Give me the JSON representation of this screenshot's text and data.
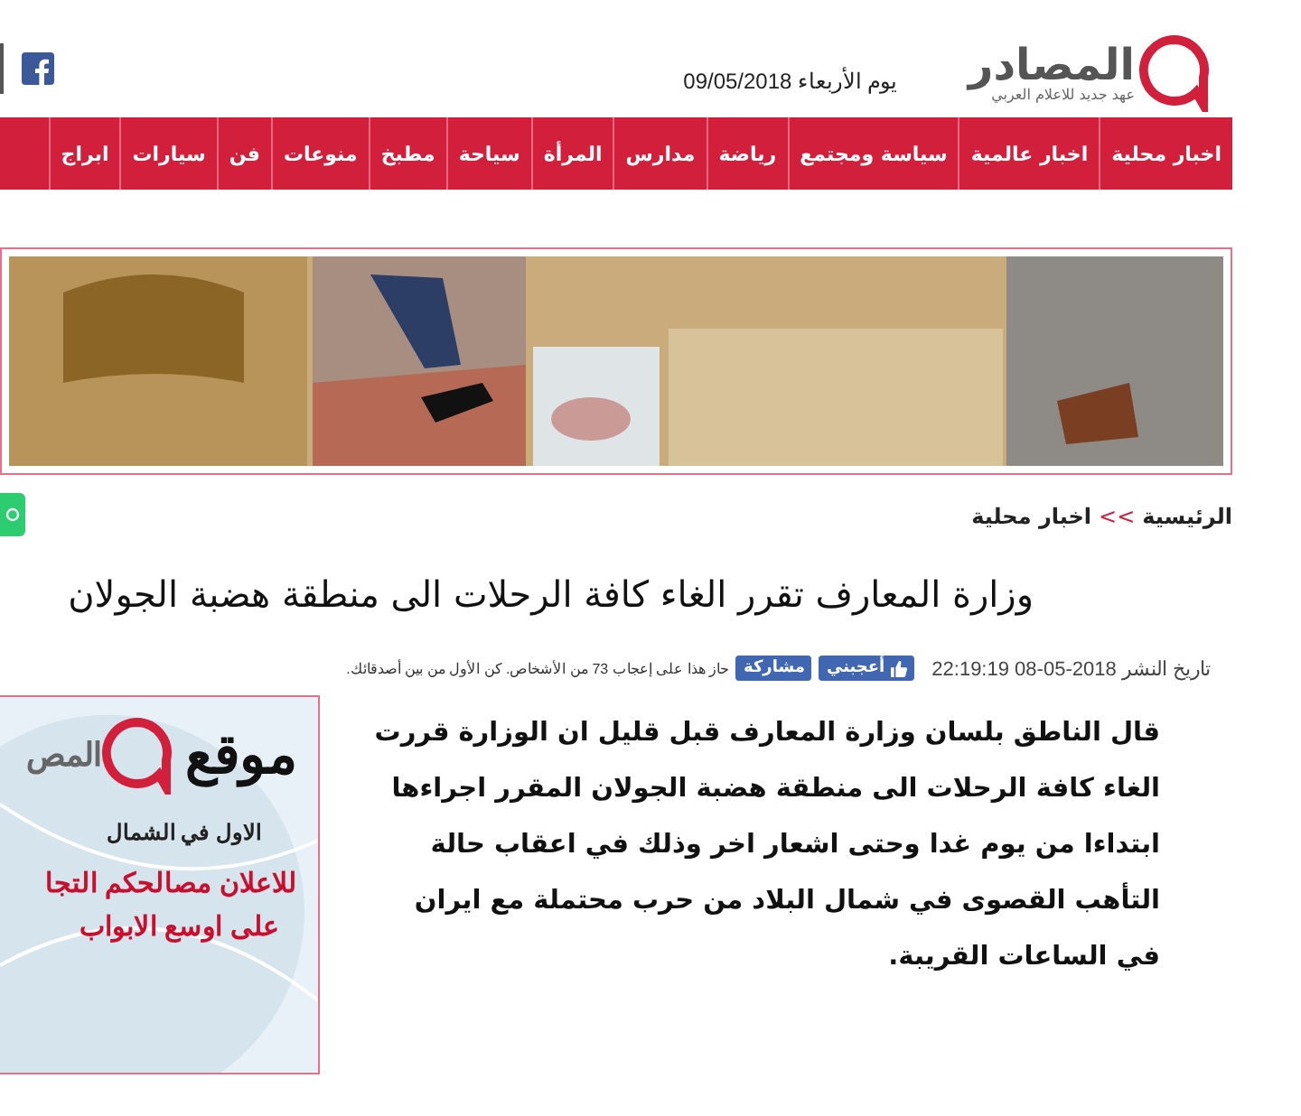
{
  "header": {
    "logo": {
      "name": "المصادر",
      "tagline": "عهد جديد للاعلام العربي"
    },
    "date": "يوم الأربعاء 09/05/2018"
  },
  "nav": [
    {
      "label": "اخبار محلية"
    },
    {
      "label": "اخبار عالمية"
    },
    {
      "label": "سياسة ومجتمع"
    },
    {
      "label": "رياضة"
    },
    {
      "label": "مدارس"
    },
    {
      "label": "المرأة"
    },
    {
      "label": "سياحة"
    },
    {
      "label": "مطبخ"
    },
    {
      "label": "منوعات"
    },
    {
      "label": "فن"
    },
    {
      "label": "سيارات"
    },
    {
      "label": "ابراج"
    }
  ],
  "breadcrumb": {
    "home": "الرئيسية",
    "separator": ">>",
    "current": "اخبار محلية"
  },
  "article": {
    "title": "وزارة المعارف تقرر الغاء كافة الرحلات الى منطقة هضبة الجولان",
    "published": "تاريخ النشر 2018-05-08 22:19:19",
    "like_button": "أعجبني",
    "share_button": "مشاركة",
    "like_note": "حاز هذا على إعجاب 73 من الأشخاص. كن الأول من بين أصدقائك.",
    "body": "قال الناطق بلسان وزارة المعارف قبل قليل ان الوزارة قررت الغاء كافة الرحلات الى منطقة هضبة الجولان المقرر اجراءها ابتداءا من يوم غدا وحتى اشعار اخر وذلك في اعقاب حالة التأهب القصوى في شمال البلاد من حرب محتملة مع ايران في الساعات القريبة."
  },
  "side_ad": {
    "logo": "المص",
    "headline": "موقع",
    "subline": "الاول في الشمال",
    "slogan_1": "للاعلان مصالحكم التجا",
    "slogan_2": "على اوسع الابواب"
  }
}
